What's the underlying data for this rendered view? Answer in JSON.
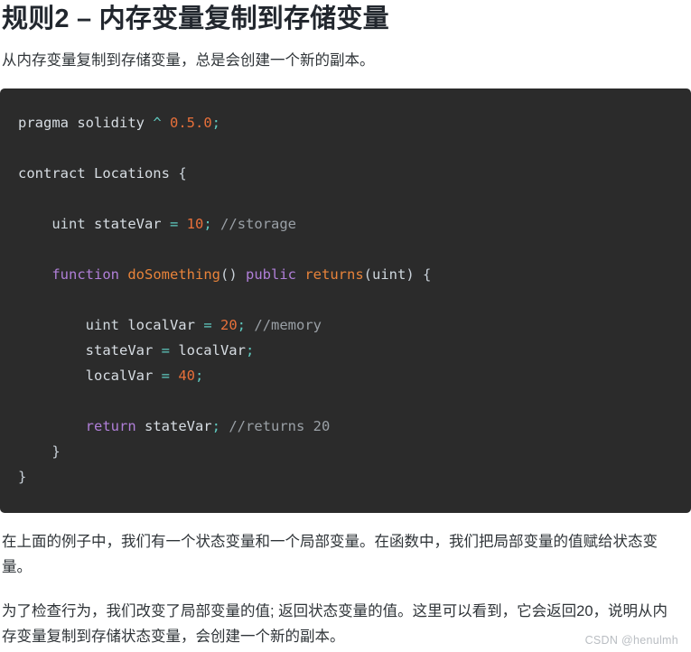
{
  "heading": "规则2 – 内存变量复制到存储变量",
  "lead": "从内存变量复制到存储变量，总是会创建一个新的副本。",
  "code": {
    "language": "solidity",
    "background_color": "#2b2b2b",
    "lines": [
      {
        "id": "l1",
        "text": "pragma solidity ^ 0.5.0;"
      },
      {
        "id": "l2",
        "text": ""
      },
      {
        "id": "l3",
        "text": "contract Locations {"
      },
      {
        "id": "l4",
        "text": ""
      },
      {
        "id": "l5",
        "text": "    uint stateVar = 10; //storage"
      },
      {
        "id": "l6",
        "text": ""
      },
      {
        "id": "l7",
        "text": "    function doSomething() public returns(uint) {"
      },
      {
        "id": "l8",
        "text": ""
      },
      {
        "id": "l9",
        "text": "        uint localVar = 20; //memory"
      },
      {
        "id": "l10",
        "text": "        stateVar = localVar;"
      },
      {
        "id": "l11",
        "text": "        localVar = 40;"
      },
      {
        "id": "l12",
        "text": ""
      },
      {
        "id": "l13",
        "text": "        return stateVar; //returns 20"
      },
      {
        "id": "l14",
        "text": "    }"
      },
      {
        "id": "l15",
        "text": "}"
      }
    ],
    "token_colors": {
      "plain": "#d7dde3",
      "keyword": "#b07fd8",
      "function": "#e8833a",
      "number": "#e8703a",
      "operator": "#5fc9bf",
      "comment": "#9aa0a6"
    }
  },
  "paragraphs": [
    "在上面的例子中，我们有一个状态变量和一个局部变量。在函数中，我们把局部变量的值赋给状态变量。",
    "为了检查行为，我们改变了局部变量的值; 返回状态变量的值。这里可以看到，它会返回20，说明从内存变量复制到存储状态变量，会创建一个新的副本。"
  ],
  "watermark": "CSDN @henulmh"
}
